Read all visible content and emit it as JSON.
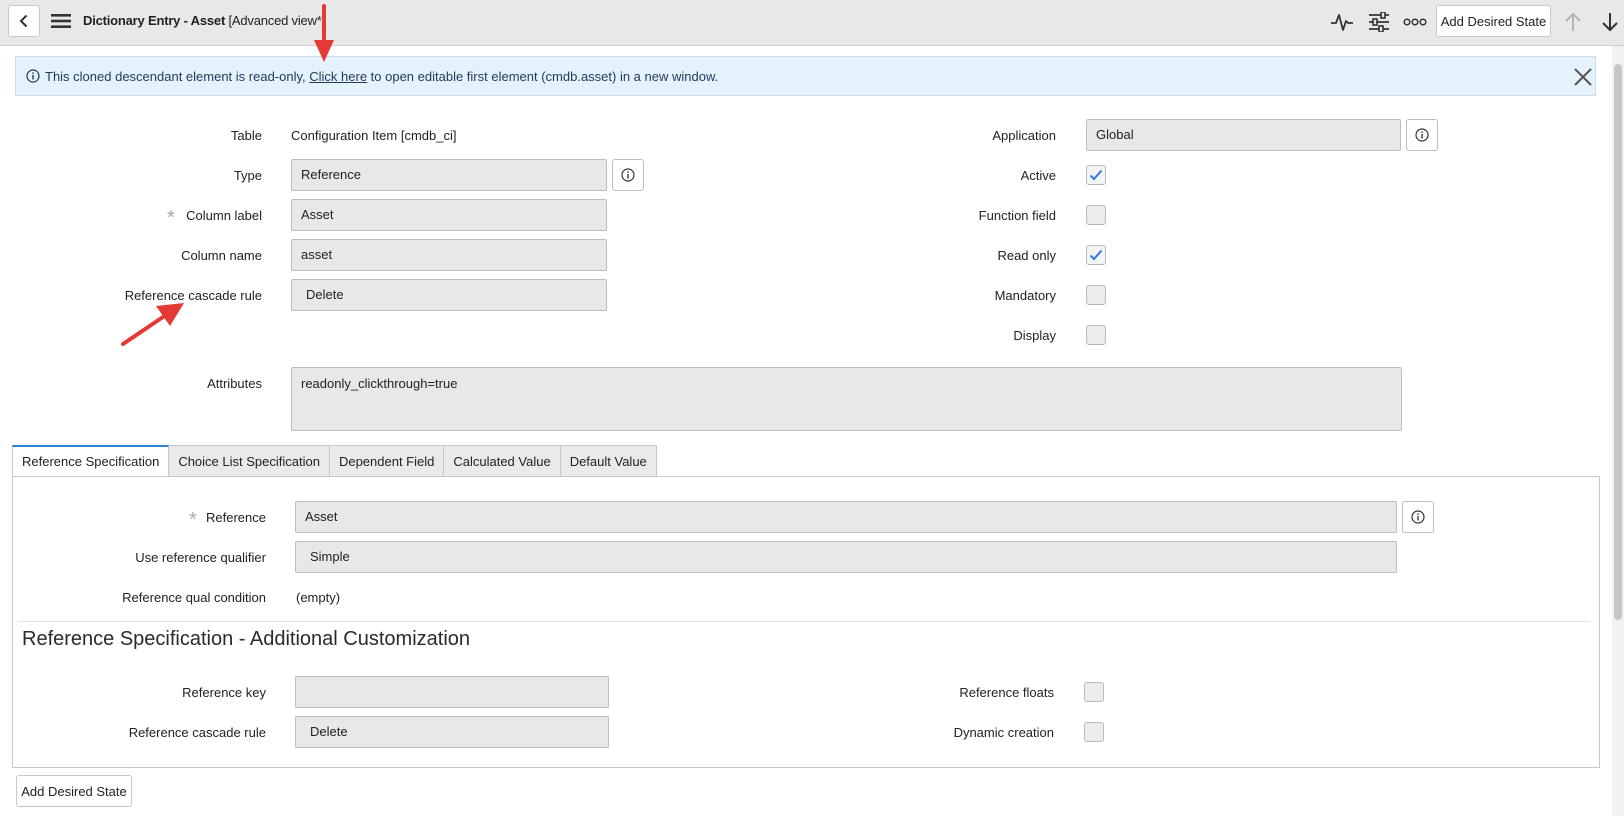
{
  "header": {
    "title": "Dictionary Entry - Asset",
    "view": "[Advanced view*]",
    "add_desired_state_label": "Add Desired State"
  },
  "banner": {
    "text_before": "This cloned descendant element is read-only, ",
    "link_text": "Click here",
    "text_after": " to open editable first element (cmdb.asset) in a new window."
  },
  "form": {
    "table_label": "Table",
    "table_value": "Configuration Item [cmdb_ci]",
    "type_label": "Type",
    "type_value": "Reference",
    "column_label_label": "Column label",
    "column_label_value": "Asset",
    "column_name_label": "Column name",
    "column_name_value": "asset",
    "cascade_rule_label": "Reference cascade rule",
    "cascade_rule_value": "Delete",
    "attributes_label": "Attributes",
    "attributes_value": "readonly_clickthrough=true",
    "application_label": "Application",
    "application_value": "Global",
    "active_label": "Active",
    "active_checked": true,
    "function_field_label": "Function field",
    "function_field_checked": false,
    "read_only_label": "Read only",
    "read_only_checked": true,
    "mandatory_label": "Mandatory",
    "mandatory_checked": false,
    "display_label": "Display",
    "display_checked": false
  },
  "tabs": [
    {
      "label": "Reference Specification",
      "active": true
    },
    {
      "label": "Choice List Specification",
      "active": false
    },
    {
      "label": "Dependent Field",
      "active": false
    },
    {
      "label": "Calculated Value",
      "active": false
    },
    {
      "label": "Default Value",
      "active": false
    }
  ],
  "reference_spec": {
    "reference_label": "Reference",
    "reference_value": "Asset",
    "qualifier_label": "Use reference qualifier",
    "qualifier_value": "Simple",
    "qual_condition_label": "Reference qual condition",
    "qual_condition_value": "(empty)",
    "section_title": "Reference Specification - Additional Customization",
    "reference_key_label": "Reference key",
    "reference_key_value": "",
    "cascade_rule_label": "Reference cascade rule",
    "cascade_rule_value": "Delete",
    "floats_label": "Reference floats",
    "floats_checked": false,
    "dynamic_creation_label": "Dynamic creation",
    "dynamic_creation_checked": false
  },
  "footer": {
    "add_desired_state_label": "Add Desired State"
  },
  "icons": {
    "back": "chevron-left-icon",
    "menu": "hamburger-menu-icon",
    "activity": "activity-stream-icon",
    "settings": "sliders-icon",
    "more": "more-options-icon",
    "up": "arrow-up-icon",
    "down": "arrow-down-icon",
    "info": "info-icon",
    "close": "close-icon",
    "check": "checkmark-icon"
  },
  "colors": {
    "banner_bg": "#e5f1fb",
    "tab_accent": "#2c86d1",
    "checkmark": "#2c7fd1",
    "annotation_arrow": "#e53935"
  }
}
